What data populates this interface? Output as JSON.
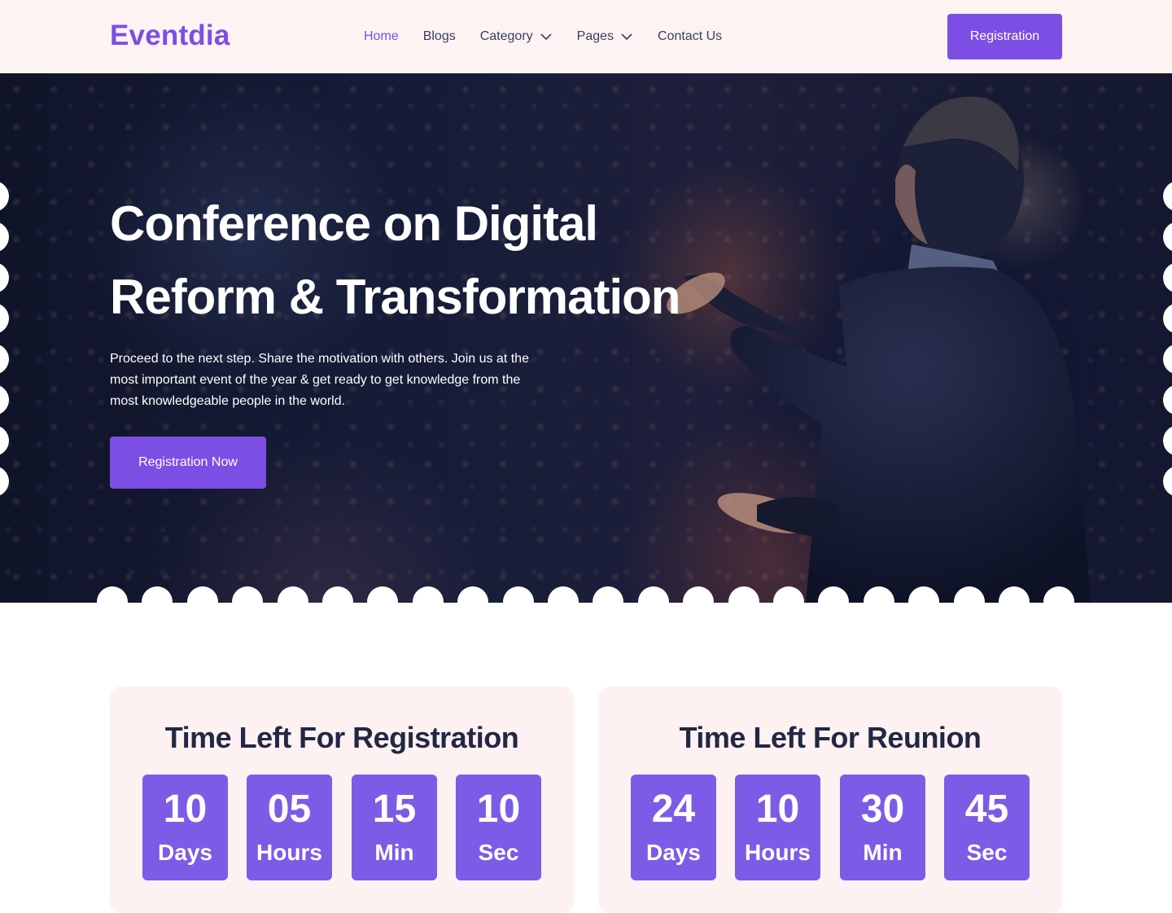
{
  "brand": {
    "logo": "Eventdia",
    "accent_color": "#7c4ee4"
  },
  "nav": {
    "items": [
      {
        "label": "Home",
        "active": true,
        "dropdown": false
      },
      {
        "label": "Blogs",
        "active": false,
        "dropdown": false
      },
      {
        "label": "Category",
        "active": false,
        "dropdown": true
      },
      {
        "label": "Pages",
        "active": false,
        "dropdown": true
      },
      {
        "label": "Contact Us",
        "active": false,
        "dropdown": false
      }
    ],
    "cta_label": "Registration"
  },
  "hero": {
    "title_line1": "Conference on Digital",
    "title_line2": "Reform & Transformation",
    "description": "Proceed to the next step. Share the motivation with others. Join us at the most important event of the year & get ready to get knowledge from the most knowledgeable people in the world.",
    "cta_label": "Registration Now",
    "background": "speaker-on-stage-photo"
  },
  "countdowns": [
    {
      "title": "Time Left For Registration",
      "units": [
        {
          "value": "10",
          "unit": "Days"
        },
        {
          "value": "05",
          "unit": "Hours"
        },
        {
          "value": "15",
          "unit": "Min"
        },
        {
          "value": "10",
          "unit": "Sec"
        }
      ]
    },
    {
      "title": "Time Left For Reunion",
      "units": [
        {
          "value": "24",
          "unit": "Days"
        },
        {
          "value": "10",
          "unit": "Hours"
        },
        {
          "value": "30",
          "unit": "Min"
        },
        {
          "value": "45",
          "unit": "Sec"
        }
      ]
    }
  ]
}
